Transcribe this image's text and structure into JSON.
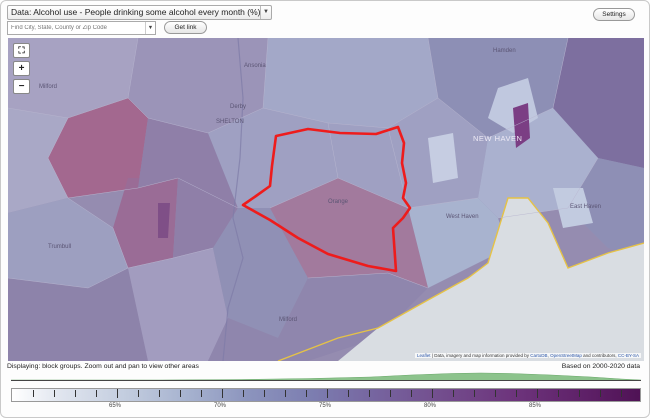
{
  "controls": {
    "data_prefix": "Data:",
    "data_value": "Alcohol use - People drinking some alcohol every month (%)",
    "settings_label": "Settings",
    "search_placeholder": "Find City, State, County or Zip Code",
    "get_link_label": "Get link"
  },
  "map": {
    "zoom_in": "+",
    "zoom_out": "−",
    "fullscreen_glyph": "⛶",
    "places": {
      "milford": "Milford",
      "ansonia": "Ansonia",
      "derby": "Derby",
      "shelton": "SHELTON",
      "new_haven": "NEW HAVEN",
      "hamden": "Hamden",
      "orange": "Orange",
      "west_haven": "West Haven",
      "east_haven": "East Haven",
      "trumbull": "Trumbull",
      "milford_south": "Milford"
    },
    "attribution": {
      "leaflet": "Leaflet",
      "text1": "| Data, imagery and map information provided by",
      "cartodb": "CartoDB",
      "text2": ",",
      "osm": "OpenStreetMap",
      "text3": "and contributors,",
      "license": "CC-BY-SA"
    },
    "colors": {
      "highlight": "#ee1c1c",
      "coastline": "#e5c247",
      "water": "#d9dde2"
    }
  },
  "footer": {
    "displaying": "Displaying: block groups. Zoom out and pan to view other areas",
    "based_on": "Based on 2000-2020 data"
  },
  "legend": {
    "labels": [
      "65%",
      "70%",
      "75%",
      "80%",
      "85%"
    ],
    "colors": {
      "low": "#ffffff",
      "high": "#4f1255",
      "histogram": "#8cc38c"
    }
  }
}
